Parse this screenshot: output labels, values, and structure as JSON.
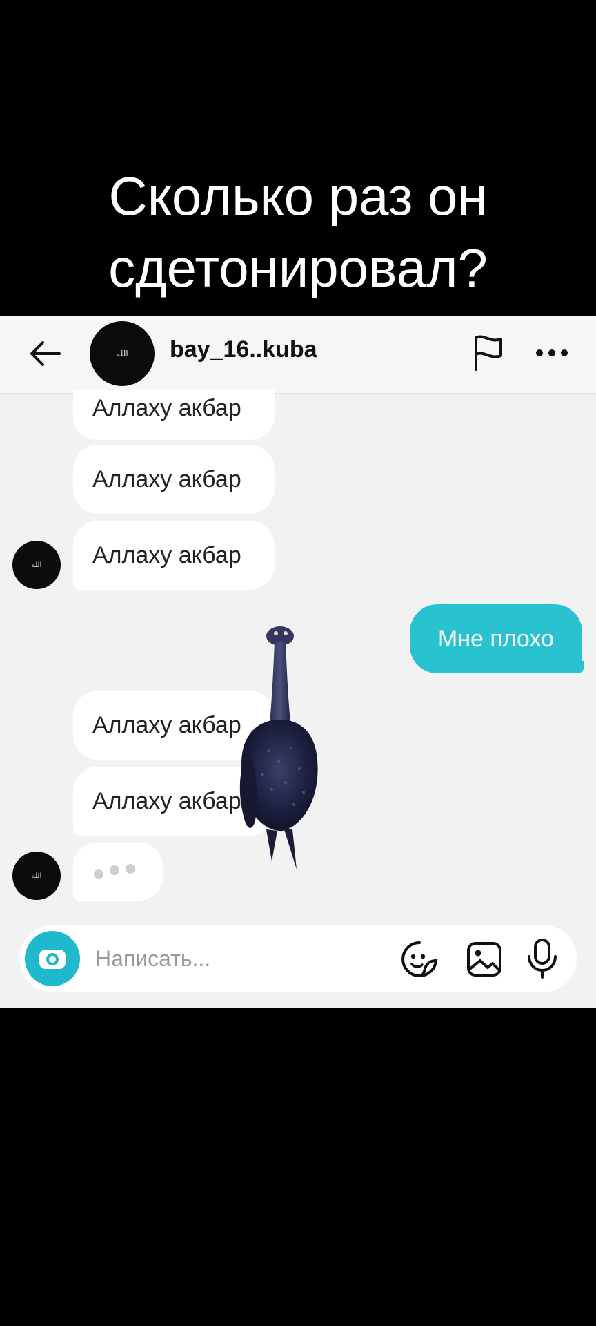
{
  "caption": {
    "line1": "Сколько раз он",
    "line2": "сдетонировал?"
  },
  "header": {
    "back_icon": "arrow-left-icon",
    "avatar_text": "الله",
    "username": "bay_16..kuba",
    "flag_icon": "flag-icon",
    "more_icon": "more-horizontal-icon"
  },
  "messages": [
    {
      "direction": "received",
      "text": "Аллаху акбар"
    },
    {
      "direction": "received",
      "text": "Аллаху акбар"
    },
    {
      "direction": "received",
      "text": "Аллаху акбар"
    },
    {
      "direction": "sent",
      "text": "Мне плохо"
    },
    {
      "direction": "received",
      "text": "Аллаху акбар"
    },
    {
      "direction": "received",
      "text": "Аллаху акбар"
    }
  ],
  "avatar_small_text": "الله",
  "typing_indicator": true,
  "composer": {
    "placeholder": "Написать...",
    "camera_icon": "camera-icon",
    "sticker_icon": "sticker-icon",
    "gallery_icon": "gallery-icon",
    "mic_icon": "microphone-icon"
  },
  "colors": {
    "sent_bubble": "#29c2d0",
    "received_bubble": "#ffffff",
    "chat_background": "#f2f2f2",
    "camera_button": "#1fb8cc"
  }
}
